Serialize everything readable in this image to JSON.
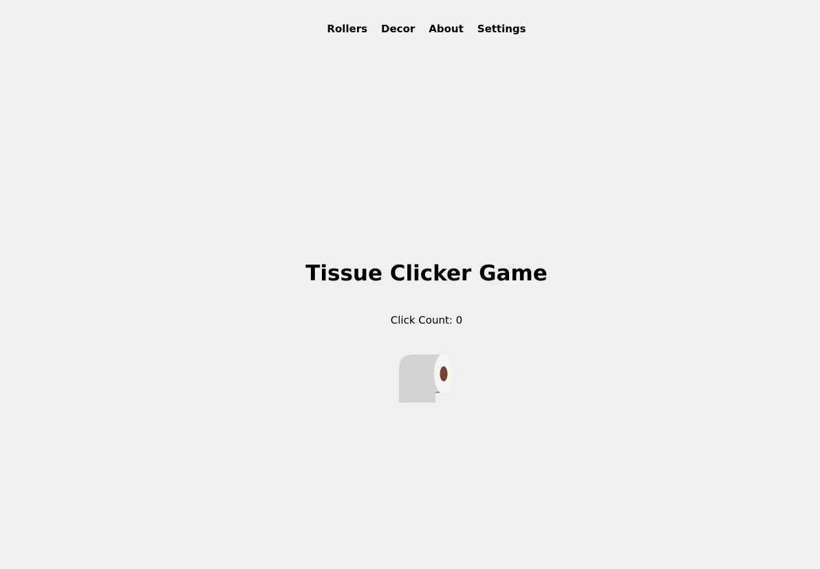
{
  "nav": {
    "items": [
      {
        "label": "Rollers"
      },
      {
        "label": "Decor"
      },
      {
        "label": "About"
      },
      {
        "label": "Settings"
      }
    ]
  },
  "game": {
    "title": "Tissue Clicker Game",
    "click_count_label": "Click Count: 0",
    "click_count": 0
  },
  "colors": {
    "background": "#f0f0f0",
    "roll_paper": "#d3d3d3",
    "roll_end": "#f5f5f5",
    "roll_core": "#7a4033"
  },
  "icons": {
    "roll": "toilet-paper-roll-icon"
  }
}
